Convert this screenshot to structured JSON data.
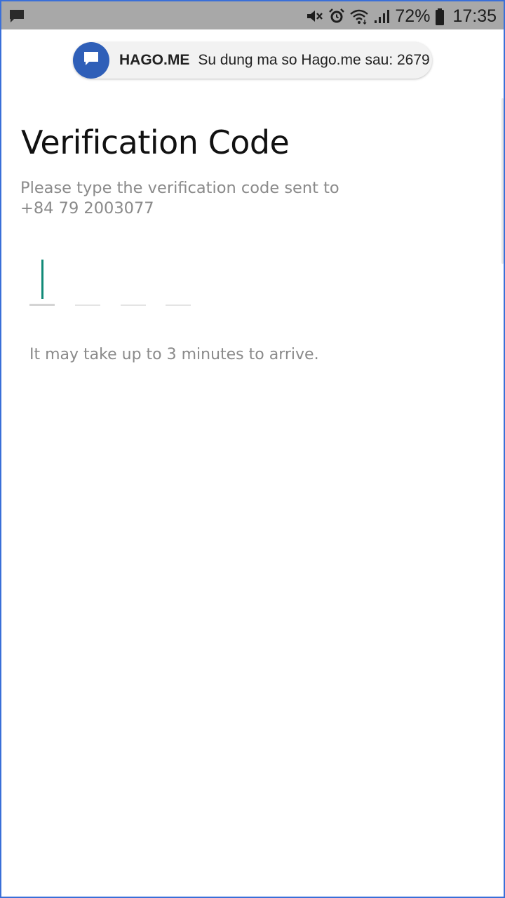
{
  "status_bar": {
    "left_icon": "message-icon",
    "icons": [
      "mute-icon",
      "alarm-icon",
      "wifi-icon",
      "signal-icon"
    ],
    "battery_percent": "72%",
    "battery_icon": "battery-icon",
    "time": "17:35"
  },
  "notification": {
    "icon": "message-icon",
    "sender": "HAGO.ME",
    "message": "Su dung ma so Hago.me sau: 2679"
  },
  "verification": {
    "title": "Verification Code",
    "subtitle": "Please type the verification code sent to +84 79 2003077",
    "code_digits": [
      "",
      "",
      "",
      ""
    ],
    "active_slot": 0,
    "hint": "It may take up to 3 minutes to arrive."
  },
  "colors": {
    "status_bar_bg": "#a8a8a8",
    "accent_cursor": "#118a78",
    "notification_avatar": "#2f5fb8",
    "secondary_text": "#8a8a8a"
  }
}
